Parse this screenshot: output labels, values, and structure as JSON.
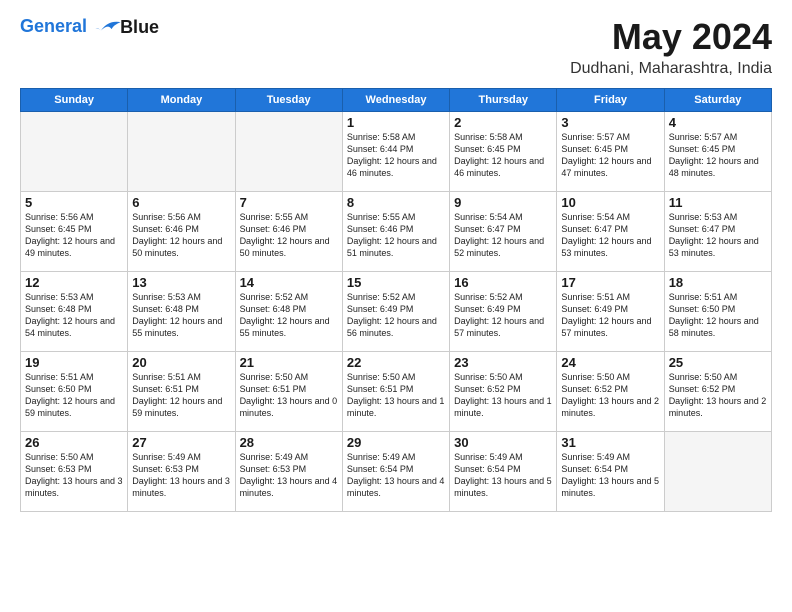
{
  "logo": {
    "line1": "General",
    "line2": "Blue"
  },
  "title": "May 2024",
  "subtitle": "Dudhani, Maharashtra, India",
  "days": [
    "Sunday",
    "Monday",
    "Tuesday",
    "Wednesday",
    "Thursday",
    "Friday",
    "Saturday"
  ],
  "weeks": [
    [
      {
        "date": "",
        "sunrise": "",
        "sunset": "",
        "daylight": ""
      },
      {
        "date": "",
        "sunrise": "",
        "sunset": "",
        "daylight": ""
      },
      {
        "date": "",
        "sunrise": "",
        "sunset": "",
        "daylight": ""
      },
      {
        "date": "1",
        "sunrise": "Sunrise: 5:58 AM",
        "sunset": "Sunset: 6:44 PM",
        "daylight": "Daylight: 12 hours and 46 minutes."
      },
      {
        "date": "2",
        "sunrise": "Sunrise: 5:58 AM",
        "sunset": "Sunset: 6:45 PM",
        "daylight": "Daylight: 12 hours and 46 minutes."
      },
      {
        "date": "3",
        "sunrise": "Sunrise: 5:57 AM",
        "sunset": "Sunset: 6:45 PM",
        "daylight": "Daylight: 12 hours and 47 minutes."
      },
      {
        "date": "4",
        "sunrise": "Sunrise: 5:57 AM",
        "sunset": "Sunset: 6:45 PM",
        "daylight": "Daylight: 12 hours and 48 minutes."
      }
    ],
    [
      {
        "date": "5",
        "sunrise": "Sunrise: 5:56 AM",
        "sunset": "Sunset: 6:45 PM",
        "daylight": "Daylight: 12 hours and 49 minutes."
      },
      {
        "date": "6",
        "sunrise": "Sunrise: 5:56 AM",
        "sunset": "Sunset: 6:46 PM",
        "daylight": "Daylight: 12 hours and 50 minutes."
      },
      {
        "date": "7",
        "sunrise": "Sunrise: 5:55 AM",
        "sunset": "Sunset: 6:46 PM",
        "daylight": "Daylight: 12 hours and 50 minutes."
      },
      {
        "date": "8",
        "sunrise": "Sunrise: 5:55 AM",
        "sunset": "Sunset: 6:46 PM",
        "daylight": "Daylight: 12 hours and 51 minutes."
      },
      {
        "date": "9",
        "sunrise": "Sunrise: 5:54 AM",
        "sunset": "Sunset: 6:47 PM",
        "daylight": "Daylight: 12 hours and 52 minutes."
      },
      {
        "date": "10",
        "sunrise": "Sunrise: 5:54 AM",
        "sunset": "Sunset: 6:47 PM",
        "daylight": "Daylight: 12 hours and 53 minutes."
      },
      {
        "date": "11",
        "sunrise": "Sunrise: 5:53 AM",
        "sunset": "Sunset: 6:47 PM",
        "daylight": "Daylight: 12 hours and 53 minutes."
      }
    ],
    [
      {
        "date": "12",
        "sunrise": "Sunrise: 5:53 AM",
        "sunset": "Sunset: 6:48 PM",
        "daylight": "Daylight: 12 hours and 54 minutes."
      },
      {
        "date": "13",
        "sunrise": "Sunrise: 5:53 AM",
        "sunset": "Sunset: 6:48 PM",
        "daylight": "Daylight: 12 hours and 55 minutes."
      },
      {
        "date": "14",
        "sunrise": "Sunrise: 5:52 AM",
        "sunset": "Sunset: 6:48 PM",
        "daylight": "Daylight: 12 hours and 55 minutes."
      },
      {
        "date": "15",
        "sunrise": "Sunrise: 5:52 AM",
        "sunset": "Sunset: 6:49 PM",
        "daylight": "Daylight: 12 hours and 56 minutes."
      },
      {
        "date": "16",
        "sunrise": "Sunrise: 5:52 AM",
        "sunset": "Sunset: 6:49 PM",
        "daylight": "Daylight: 12 hours and 57 minutes."
      },
      {
        "date": "17",
        "sunrise": "Sunrise: 5:51 AM",
        "sunset": "Sunset: 6:49 PM",
        "daylight": "Daylight: 12 hours and 57 minutes."
      },
      {
        "date": "18",
        "sunrise": "Sunrise: 5:51 AM",
        "sunset": "Sunset: 6:50 PM",
        "daylight": "Daylight: 12 hours and 58 minutes."
      }
    ],
    [
      {
        "date": "19",
        "sunrise": "Sunrise: 5:51 AM",
        "sunset": "Sunset: 6:50 PM",
        "daylight": "Daylight: 12 hours and 59 minutes."
      },
      {
        "date": "20",
        "sunrise": "Sunrise: 5:51 AM",
        "sunset": "Sunset: 6:51 PM",
        "daylight": "Daylight: 12 hours and 59 minutes."
      },
      {
        "date": "21",
        "sunrise": "Sunrise: 5:50 AM",
        "sunset": "Sunset: 6:51 PM",
        "daylight": "Daylight: 13 hours and 0 minutes."
      },
      {
        "date": "22",
        "sunrise": "Sunrise: 5:50 AM",
        "sunset": "Sunset: 6:51 PM",
        "daylight": "Daylight: 13 hours and 1 minute."
      },
      {
        "date": "23",
        "sunrise": "Sunrise: 5:50 AM",
        "sunset": "Sunset: 6:52 PM",
        "daylight": "Daylight: 13 hours and 1 minute."
      },
      {
        "date": "24",
        "sunrise": "Sunrise: 5:50 AM",
        "sunset": "Sunset: 6:52 PM",
        "daylight": "Daylight: 13 hours and 2 minutes."
      },
      {
        "date": "25",
        "sunrise": "Sunrise: 5:50 AM",
        "sunset": "Sunset: 6:52 PM",
        "daylight": "Daylight: 13 hours and 2 minutes."
      }
    ],
    [
      {
        "date": "26",
        "sunrise": "Sunrise: 5:50 AM",
        "sunset": "Sunset: 6:53 PM",
        "daylight": "Daylight: 13 hours and 3 minutes."
      },
      {
        "date": "27",
        "sunrise": "Sunrise: 5:49 AM",
        "sunset": "Sunset: 6:53 PM",
        "daylight": "Daylight: 13 hours and 3 minutes."
      },
      {
        "date": "28",
        "sunrise": "Sunrise: 5:49 AM",
        "sunset": "Sunset: 6:53 PM",
        "daylight": "Daylight: 13 hours and 4 minutes."
      },
      {
        "date": "29",
        "sunrise": "Sunrise: 5:49 AM",
        "sunset": "Sunset: 6:54 PM",
        "daylight": "Daylight: 13 hours and 4 minutes."
      },
      {
        "date": "30",
        "sunrise": "Sunrise: 5:49 AM",
        "sunset": "Sunset: 6:54 PM",
        "daylight": "Daylight: 13 hours and 5 minutes."
      },
      {
        "date": "31",
        "sunrise": "Sunrise: 5:49 AM",
        "sunset": "Sunset: 6:54 PM",
        "daylight": "Daylight: 13 hours and 5 minutes."
      },
      {
        "date": "",
        "sunrise": "",
        "sunset": "",
        "daylight": ""
      }
    ]
  ]
}
